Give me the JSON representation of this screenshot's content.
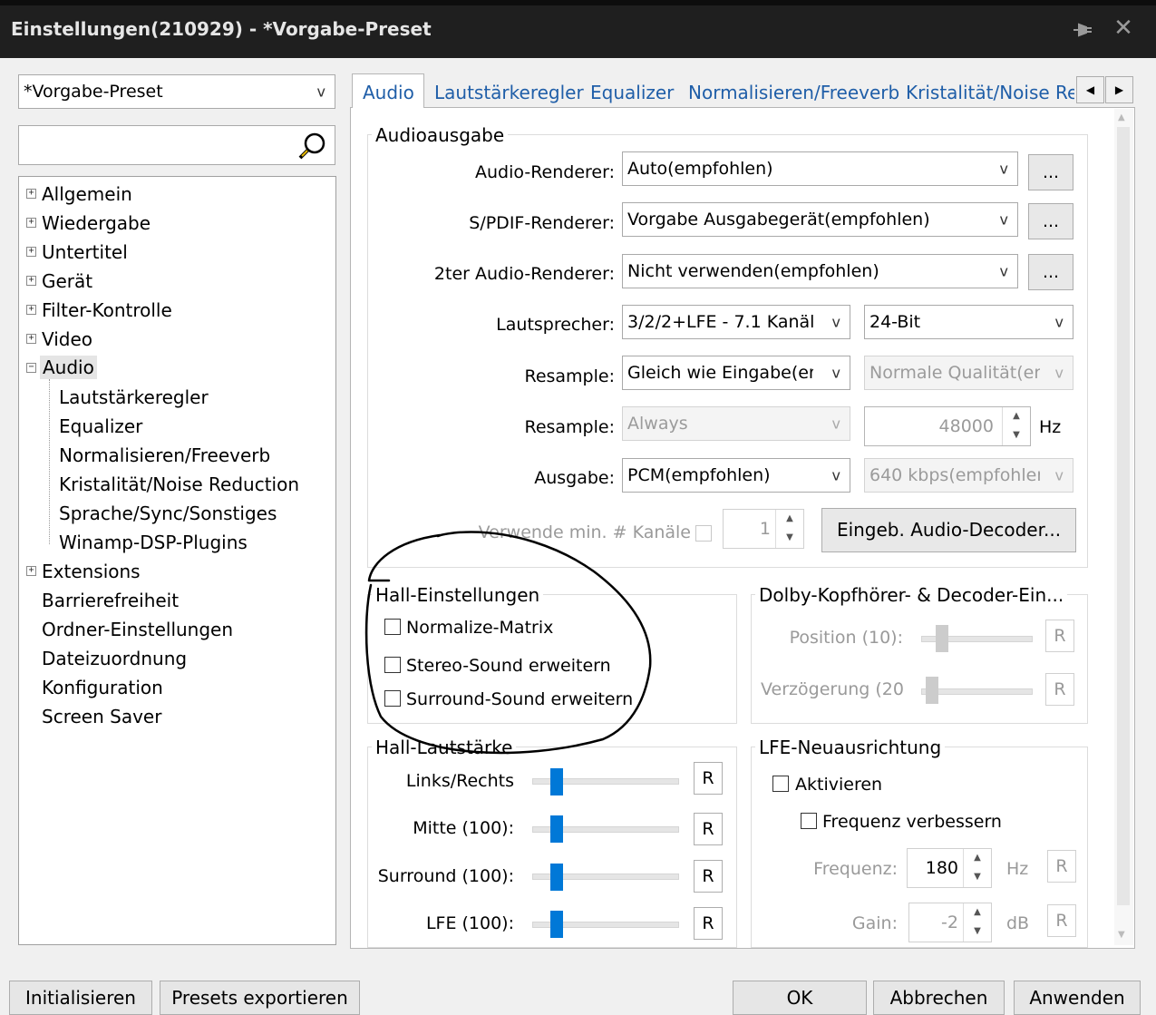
{
  "window": {
    "title": "Einstellungen(210929) - *Vorgabe-Preset"
  },
  "preset": {
    "value": "*Vorgabe-Preset",
    "arrow": "v"
  },
  "search": {
    "placeholder": ""
  },
  "tree": {
    "items": [
      {
        "label": "Allgemein"
      },
      {
        "label": "Wiedergabe"
      },
      {
        "label": "Untertitel"
      },
      {
        "label": "Gerät"
      },
      {
        "label": "Filter-Kontrolle"
      },
      {
        "label": "Video"
      },
      {
        "label": "Audio"
      },
      {
        "label": "Lautstärkeregler"
      },
      {
        "label": "Equalizer"
      },
      {
        "label": "Normalisieren/Freeverb"
      },
      {
        "label": "Kristalität/Noise Reduction"
      },
      {
        "label": "Sprache/Sync/Sonstiges"
      },
      {
        "label": "Winamp-DSP-Plugins"
      },
      {
        "label": "Extensions"
      },
      {
        "label": "Barrierefreiheit"
      },
      {
        "label": "Ordner-Einstellungen"
      },
      {
        "label": "Dateizuordnung"
      },
      {
        "label": "Konfiguration"
      },
      {
        "label": "Screen Saver"
      }
    ]
  },
  "tabs": [
    "Audio",
    "Lautstärkeregler",
    "Equalizer",
    "Normalisieren/Freeverb",
    "Kristalität/Noise Red"
  ],
  "audioausgabe": {
    "title": "Audioausgabe",
    "renderer_label": "Audio-Renderer:",
    "renderer_value": "Auto(empfohlen)",
    "spdif_label": "S/PDIF-Renderer:",
    "spdif_value": "Vorgabe Ausgabegerät(empfohlen)",
    "second_label": "2ter Audio-Renderer:",
    "second_value": "Nicht verwenden(empfohlen)",
    "dots": "...",
    "speaker_label": "Lautsprecher:",
    "speaker_value": "3/2/2+LFE - 7.1 Kanäle",
    "bit_value": "24-Bit",
    "resample_label": "Resample:",
    "resample_value": "Gleich wie Eingabe(em",
    "quality_value": "Normale Qualität(er",
    "resample2_label": "Resample:",
    "resample2_value": "Always",
    "hz_value": "48000",
    "hz_unit": "Hz",
    "output_label": "Ausgabe:",
    "output_value": "PCM(empfohlen)",
    "kbps_value": "640 kbps(empfohler",
    "minch_label": "Verwende min. # Kanäle",
    "minch_value": "1",
    "decoder_button": "Eingeb. Audio-Decoder..."
  },
  "hall": {
    "title": "Hall-Einstellungen",
    "normalize": "Normalize-Matrix",
    "stereo": "Stereo-Sound erweitern",
    "surround": "Surround-Sound erweitern"
  },
  "dolby": {
    "title": "Dolby-Kopfhörer- & Decoder-Ein...",
    "position_label": "Position (10):",
    "delay_label": "Verzögerung (20",
    "r": "R",
    "position_level": 0.15,
    "delay_level": 0.05
  },
  "hall_volume": {
    "title": "Hall-Lautstärke",
    "lr_label": "Links/Rechts",
    "mid_label": "Mitte (100):",
    "surround_label": "Surround (100):",
    "lfe_label": "LFE (100):",
    "r": "R",
    "levels": [
      0.1,
      0.1,
      0.1,
      0.1
    ]
  },
  "lfe": {
    "title": "LFE-Neuausrichtung",
    "activate": "Aktivieren",
    "freq_improve": "Frequenz verbessern",
    "freq_label": "Frequenz:",
    "freq_value": "180",
    "freq_unit": "Hz",
    "gain_label": "Gain:",
    "gain_value": "-2",
    "gain_unit": "dB",
    "r": "R"
  },
  "footer": {
    "init": "Initialisieren",
    "export": "Presets exportieren",
    "ok": "OK",
    "cancel": "Abbrechen",
    "apply": "Anwenden"
  },
  "colors": {
    "accent": "#0078d7",
    "tab_text": "#1f5ea8",
    "titlebar": "#1f1f1f"
  }
}
